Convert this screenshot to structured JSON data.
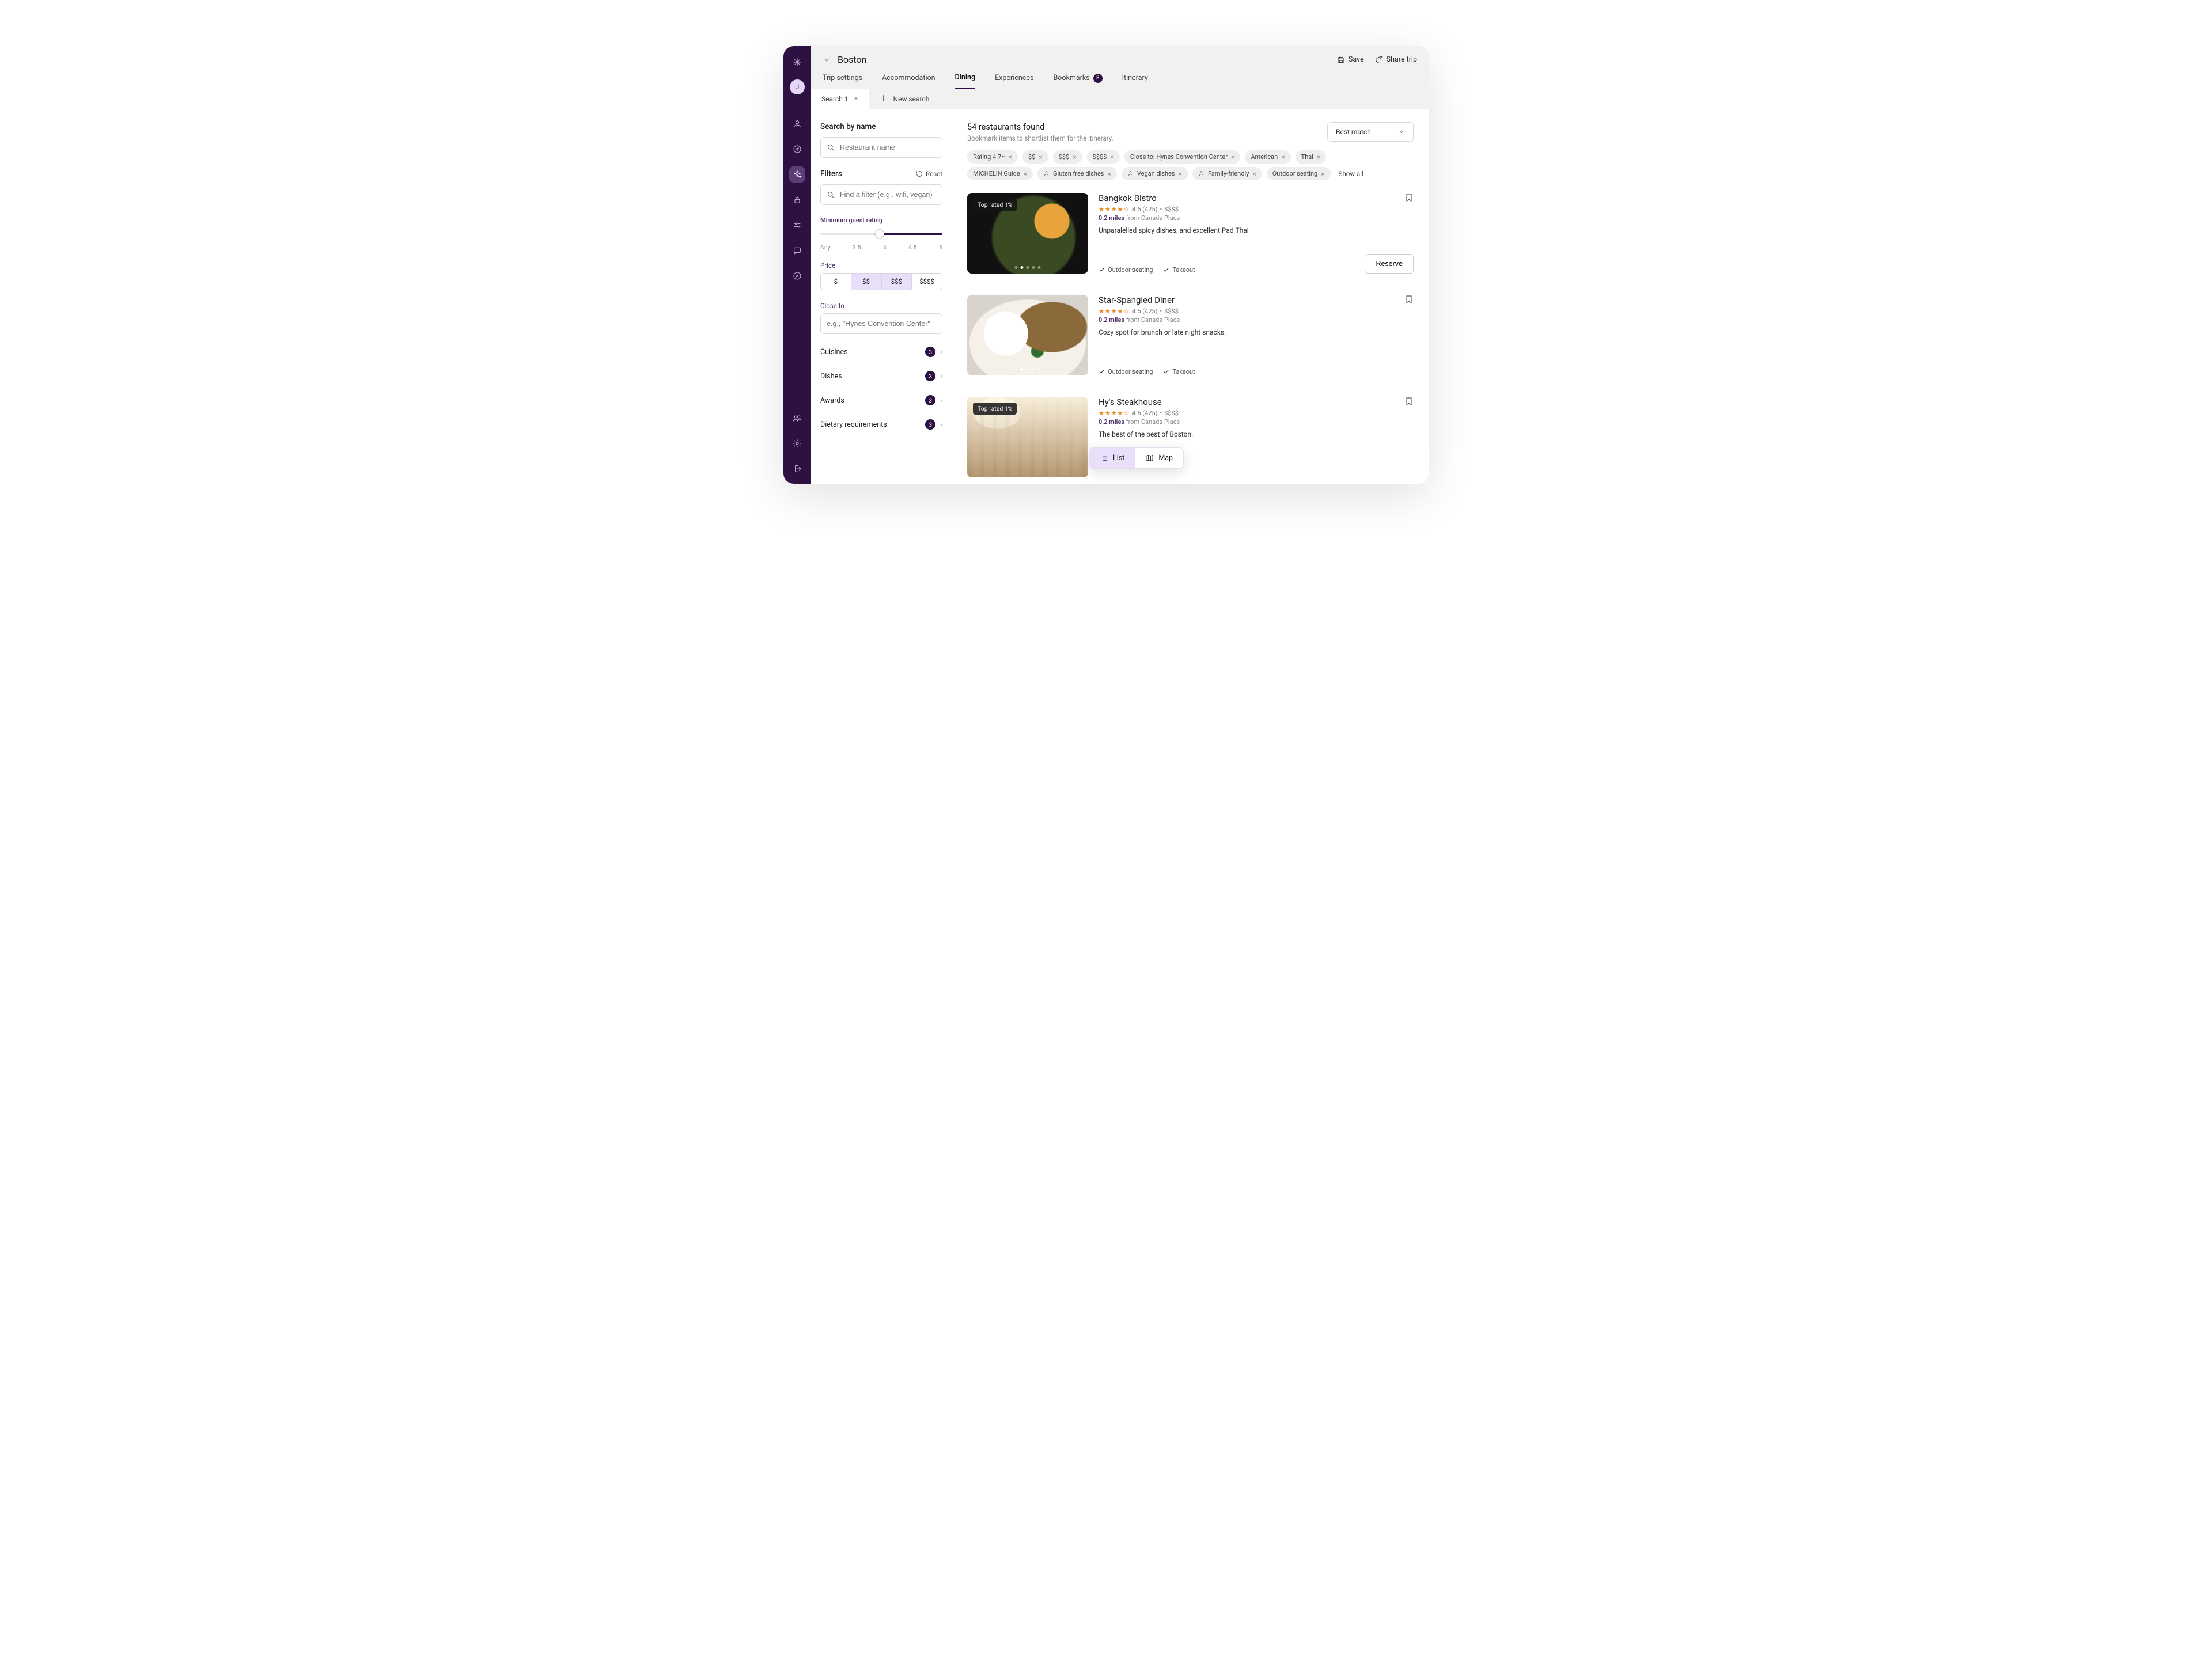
{
  "rail": {
    "avatar_initial": "J"
  },
  "header": {
    "destination": "Boston",
    "save_label": "Save",
    "share_label": "Share trip",
    "tabs": {
      "settings": "Trip settings",
      "accommodation": "Accommodation",
      "dining": "Dining",
      "experiences": "Experiences",
      "bookmarks": "Bookmarks",
      "bookmarks_count": "8",
      "itinerary": "Itinerary"
    }
  },
  "subtabs": {
    "search1": "Search 1",
    "new_search": "New search"
  },
  "filters": {
    "search_by_name": "Search by name",
    "name_placeholder": "Restaurant name",
    "filters_title": "Filters",
    "reset": "Reset",
    "filter_search_placeholder": "Find a filter (e.g., wifi, vegan)",
    "min_rating_label": "Minimum guest rating",
    "ticks": {
      "any": "Any",
      "t35": "3.5",
      "t4": "4",
      "t45": "4.5",
      "t5": "5"
    },
    "price_label": "Price",
    "prices": {
      "p1": "$",
      "p2": "$$",
      "p3": "$$$",
      "p4": "$$$$"
    },
    "close_to_label": "Close to",
    "close_to_placeholder": "e.g., \"Hynes Convention Center\"",
    "accordion": {
      "cuisines": {
        "label": "Cuisines",
        "count": "3"
      },
      "dishes": {
        "label": "Dishes",
        "count": "3"
      },
      "awards": {
        "label": "Awards",
        "count": "3"
      },
      "dietary": {
        "label": "Dietary requirements",
        "count": "3"
      }
    }
  },
  "results": {
    "heading": "54 restaurants found",
    "subheading": "Bookmark items to shortlist them for the itinerary.",
    "sort_label": "Best match",
    "show_all": "Show all",
    "chips": {
      "rating": "Rating 4.7+",
      "p2": "$$",
      "p3": "$$$",
      "p4": "$$$$",
      "closeto": "Close to: Hynes Convention Center",
      "american": "American",
      "thai": "Thai",
      "michelin": "MICHELIN Guide",
      "gf": "Gluten free dishes",
      "vegan": "Vegan dishes",
      "family": "Family-friendly",
      "outdoor": "Outdoor seating"
    },
    "tag_top": "Top rated 1%",
    "cards": [
      {
        "name": "Bangkok Bistro",
        "rating": "4.5 (425)",
        "price": "$$$$",
        "distance": "0.2 miles",
        "from": " from Canada Place",
        "desc": "Unparalelled spicy dishes, and excellent Pad Thai",
        "feat1": "Outdoor seating",
        "feat2": "Takeout",
        "top": true
      },
      {
        "name": "Star-Spangled Diner",
        "rating": "4.5 (425)",
        "price": "$$$$",
        "distance": "0.2 miles",
        "from": " from Canada Place",
        "desc": "Cozy spot for brunch or late night snacks.",
        "feat1": "Outdoor seating",
        "feat2": "Takeout",
        "top": false
      },
      {
        "name": "Hy's Steakhouse",
        "rating": "4.5 (425)",
        "price": "$$$$",
        "distance": "0.2 miles",
        "from": " from Canada Place",
        "desc": "The best of the best of Boston.",
        "top": true
      }
    ],
    "reserve": "Reserve"
  },
  "viewtoggle": {
    "list": "List",
    "map": "Map"
  }
}
